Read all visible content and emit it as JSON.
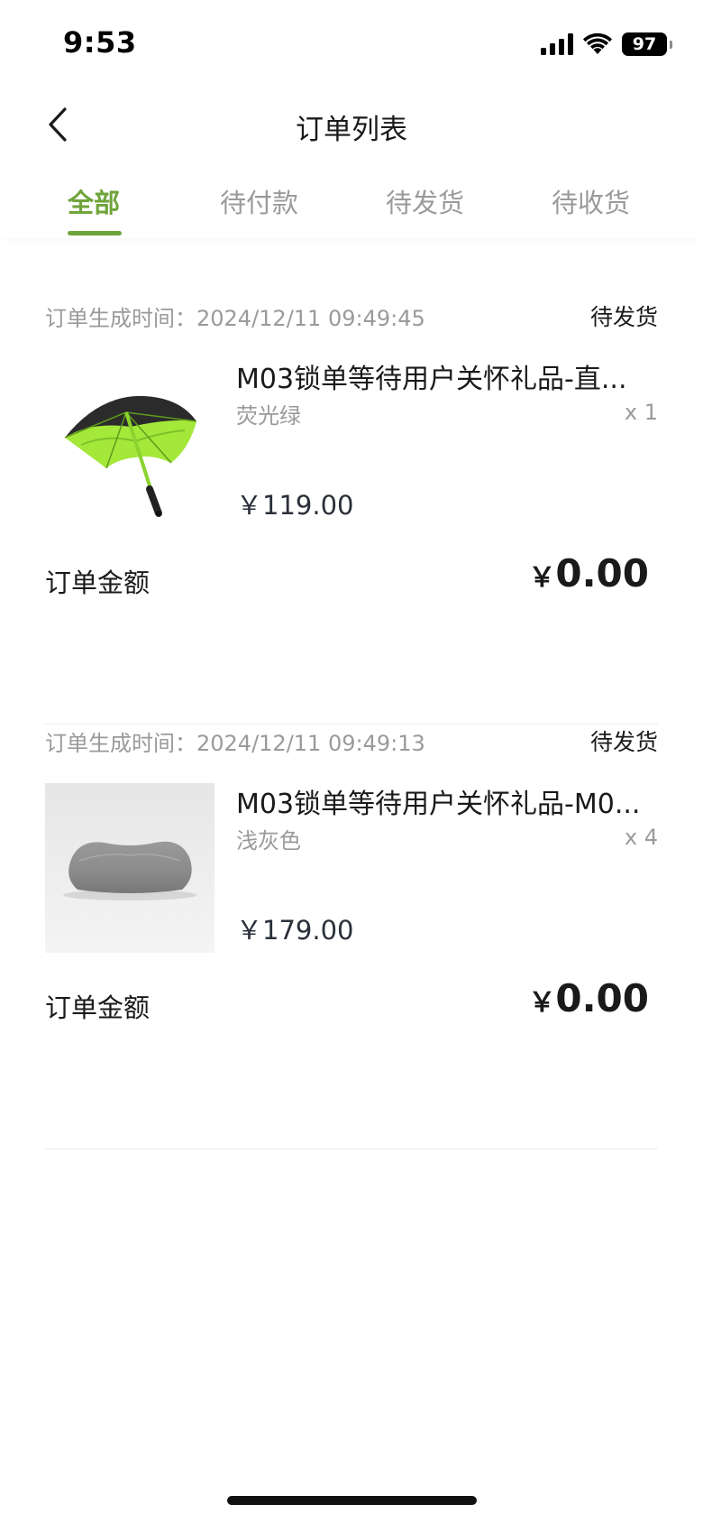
{
  "status_bar": {
    "time": "9:53",
    "battery": "97",
    "icons": [
      "signal-icon",
      "wifi-icon",
      "battery-icon"
    ]
  },
  "nav": {
    "title": "订单列表",
    "back_icon": "chevron-left-icon"
  },
  "tabs": [
    {
      "label": "全部",
      "active": true
    },
    {
      "label": "待付款",
      "active": false
    },
    {
      "label": "待发货",
      "active": false
    },
    {
      "label": "待收货",
      "active": false
    }
  ],
  "colors": {
    "accent": "#6fa43a",
    "muted_text": "#9a9a9a"
  },
  "orders": [
    {
      "time": "订单生成时间：2024/12/11 09:49:45",
      "status": "待发货",
      "product": {
        "name": "M03锁单等待用户关怀礼品-直...",
        "spec": "荧光绿",
        "qty": "x 1",
        "price": "￥119.00",
        "image": "umbrella-image"
      },
      "amount_label": "订单金额",
      "amount_currency": "￥",
      "amount_value": "0.00"
    },
    {
      "time": "订单生成时间：2024/12/11 09:49:13",
      "status": "待发货",
      "product": {
        "name": "M03锁单等待用户关怀礼品-M0...",
        "spec": "浅灰色",
        "qty": "x 4",
        "price": "￥179.00",
        "image": "pillow-image"
      },
      "amount_label": "订单金额",
      "amount_currency": "￥",
      "amount_value": "0.00"
    }
  ]
}
